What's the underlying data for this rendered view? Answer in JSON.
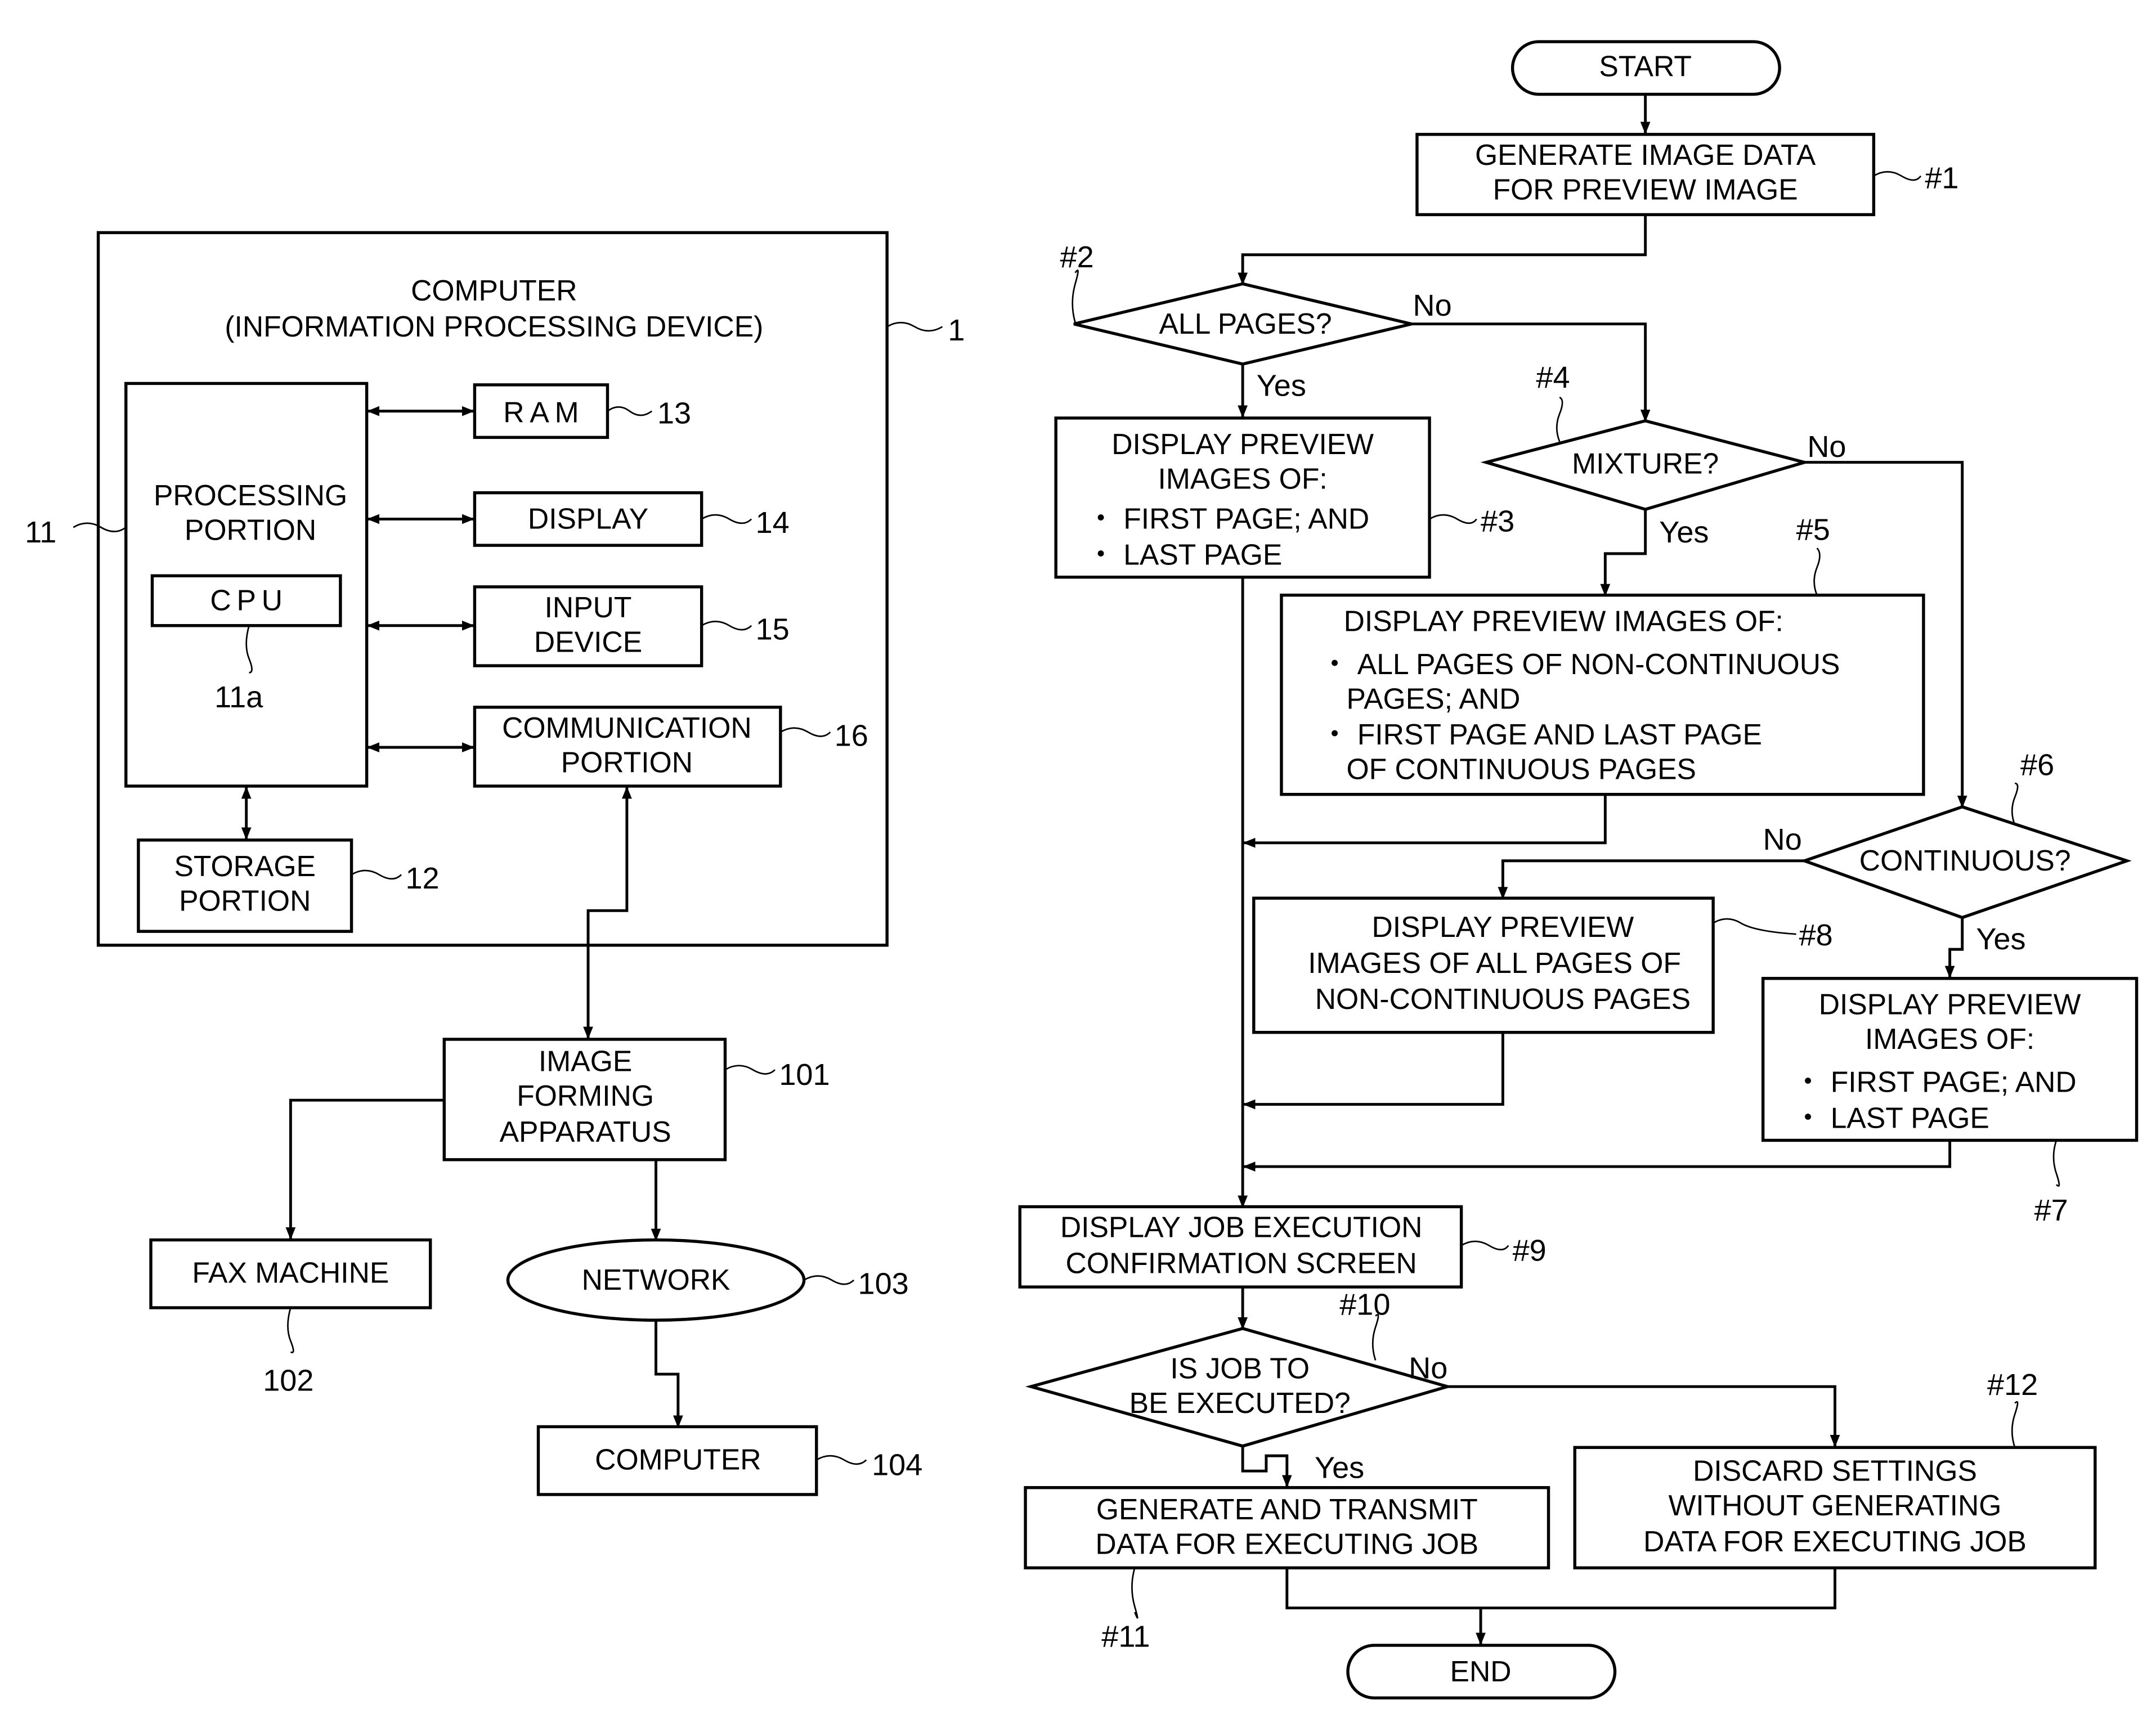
{
  "block_diagram": {
    "computer": {
      "title_line1": "COMPUTER",
      "title_line2": "(INFORMATION PROCESSING DEVICE)",
      "ref": "1"
    },
    "processing_portion": {
      "line1": "PROCESSING",
      "line2": "PORTION",
      "ref": "11"
    },
    "cpu": {
      "label": "CPU",
      "ref": "11a"
    },
    "storage_portion": {
      "line1": "STORAGE",
      "line2": "PORTION",
      "ref": "12"
    },
    "ram": {
      "label": "RAM",
      "ref": "13"
    },
    "display": {
      "label": "DISPLAY",
      "ref": "14"
    },
    "input_device": {
      "line1": "INPUT",
      "line2": "DEVICE",
      "ref": "15"
    },
    "communication_portion": {
      "line1": "COMMUNICATION",
      "line2": "PORTION",
      "ref": "16"
    },
    "image_forming_apparatus": {
      "line1": "IMAGE",
      "line2": "FORMING",
      "line3": "APPARATUS",
      "ref": "101"
    },
    "fax_machine": {
      "label": "FAX MACHINE",
      "ref": "102"
    },
    "network": {
      "label": "NETWORK",
      "ref": "103"
    },
    "computer_104": {
      "label": "COMPUTER",
      "ref": "104"
    }
  },
  "flowchart": {
    "start": "START",
    "end": "END",
    "steps": {
      "s1": {
        "ref": "#1",
        "lines": [
          "GENERATE IMAGE DATA",
          "FOR PREVIEW IMAGE"
        ]
      },
      "s2": {
        "ref": "#2",
        "lines": [
          "ALL PAGES?"
        ],
        "yes": "Yes",
        "no": "No"
      },
      "s3": {
        "ref": "#3",
        "lines": [
          "DISPLAY PREVIEW",
          "IMAGES OF:",
          "・ FIRST PAGE; AND",
          "・ LAST PAGE"
        ]
      },
      "s4": {
        "ref": "#4",
        "lines": [
          "MIXTURE?"
        ],
        "yes": "Yes",
        "no": "No"
      },
      "s5": {
        "ref": "#5",
        "lines": [
          "DISPLAY PREVIEW IMAGES OF:",
          "・ ALL PAGES OF NON-CONTINUOUS",
          "PAGES; AND",
          "・ FIRST PAGE AND LAST PAGE",
          "OF CONTINUOUS PAGES"
        ]
      },
      "s6": {
        "ref": "#6",
        "lines": [
          "CONTINUOUS?"
        ],
        "yes": "Yes",
        "no": "No"
      },
      "s7": {
        "ref": "#7",
        "lines": [
          "DISPLAY PREVIEW",
          "IMAGES OF:",
          "・ FIRST PAGE; AND",
          "・ LAST PAGE"
        ]
      },
      "s8": {
        "ref": "#8",
        "lines": [
          "DISPLAY PREVIEW",
          "IMAGES OF ALL PAGES OF",
          "NON-CONTINUOUS PAGES"
        ]
      },
      "s9": {
        "ref": "#9",
        "lines": [
          "DISPLAY JOB EXECUTION",
          "CONFIRMATION SCREEN"
        ]
      },
      "s10": {
        "ref": "#10",
        "lines": [
          "IS JOB TO",
          "BE EXECUTED?"
        ],
        "yes": "Yes",
        "no": "No"
      },
      "s11": {
        "ref": "#11",
        "lines": [
          "GENERATE AND TRANSMIT",
          "DATA FOR EXECUTING JOB"
        ]
      },
      "s12": {
        "ref": "#12",
        "lines": [
          "DISCARD SETTINGS",
          "WITHOUT GENERATING",
          "DATA FOR EXECUTING JOB"
        ]
      }
    }
  }
}
